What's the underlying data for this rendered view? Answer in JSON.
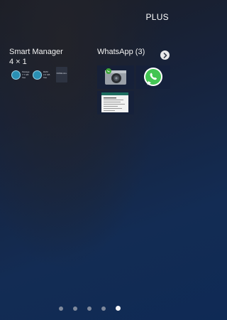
{
  "header": {
    "plus_label": "PLUS"
  },
  "smart_manager": {
    "title": "Smart Manager",
    "size": "4 × 1",
    "items": [
      {
        "text": "Storage\n7.7 GB\nfree"
      },
      {
        "text": "RAM\n2.0 GB\nfree"
      },
      {
        "text": "DONE\nALL"
      }
    ]
  },
  "whatsapp": {
    "title": "WhatsApp (3)",
    "widgets": [
      "camera-widget",
      "whatsapp-logo-widget",
      "chat-list-widget"
    ]
  },
  "page_indicator": {
    "pages": 5,
    "active_index": 4
  }
}
